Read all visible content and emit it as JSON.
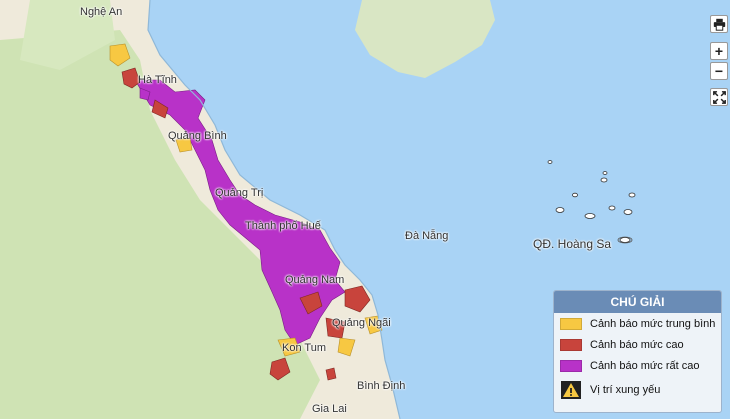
{
  "map": {
    "places": {
      "nghe_an": "Nghệ An",
      "ha_tinh": "Hà Tĩnh",
      "quang_binh": "Quảng Bình",
      "quang_tri": "Quảng Trị",
      "hue": "Thành phố Huế",
      "da_nang": "Đà Nẵng",
      "hoang_sa": "QĐ. Hoàng Sa",
      "quang_nam": "Quảng Nam",
      "quang_ngai": "Quảng Ngãi",
      "kon_tum": "Kon Tum",
      "binh_dinh": "Bình Định",
      "gia_lai": "Gia Lai"
    },
    "colors": {
      "sea": "#a9d3f5",
      "land": "#efeadb",
      "forest": "#cfe3b4",
      "medium": "#f7c842",
      "high": "#c8443c",
      "very_high": "#b832c8"
    }
  },
  "controls": {
    "print_icon": "printer-icon",
    "zoom_in": "+",
    "zoom_out": "−",
    "fullscreen_icon": "fullscreen-icon"
  },
  "legend": {
    "title": "CHÚ GIẢI",
    "items": [
      {
        "label": "Cảnh báo mức trung bình",
        "color": "#f7c842"
      },
      {
        "label": "Cảnh báo mức cao",
        "color": "#c8443c"
      },
      {
        "label": "Cảnh báo mức rất cao",
        "color": "#b832c8"
      },
      {
        "label": "Vị trí xung yếu",
        "icon": "warning-triangle-icon"
      }
    ]
  }
}
